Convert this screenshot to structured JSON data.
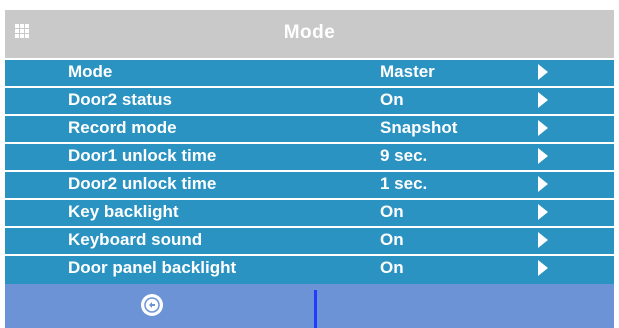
{
  "header": {
    "title": "Mode",
    "menu_icon": "grid-menu-icon"
  },
  "settings": [
    {
      "label": "Mode",
      "value": "Master"
    },
    {
      "label": "Door2 status",
      "value": "On"
    },
    {
      "label": "Record mode",
      "value": "Snapshot"
    },
    {
      "label": "Door1 unlock time",
      "value": "9 sec."
    },
    {
      "label": "Door2 unlock time",
      "value": "1 sec."
    },
    {
      "label": "Key backlight",
      "value": "On"
    },
    {
      "label": "Keyboard sound",
      "value": "On"
    },
    {
      "label": "Door panel backlight",
      "value": "On"
    }
  ],
  "footer": {
    "back_icon": "back-arrow-icon"
  },
  "colors": {
    "header_bg": "#c9c9c9",
    "list_bg": "#2a93c2",
    "footer_bg": "#6b93d6",
    "divider": "#1f3cff"
  }
}
